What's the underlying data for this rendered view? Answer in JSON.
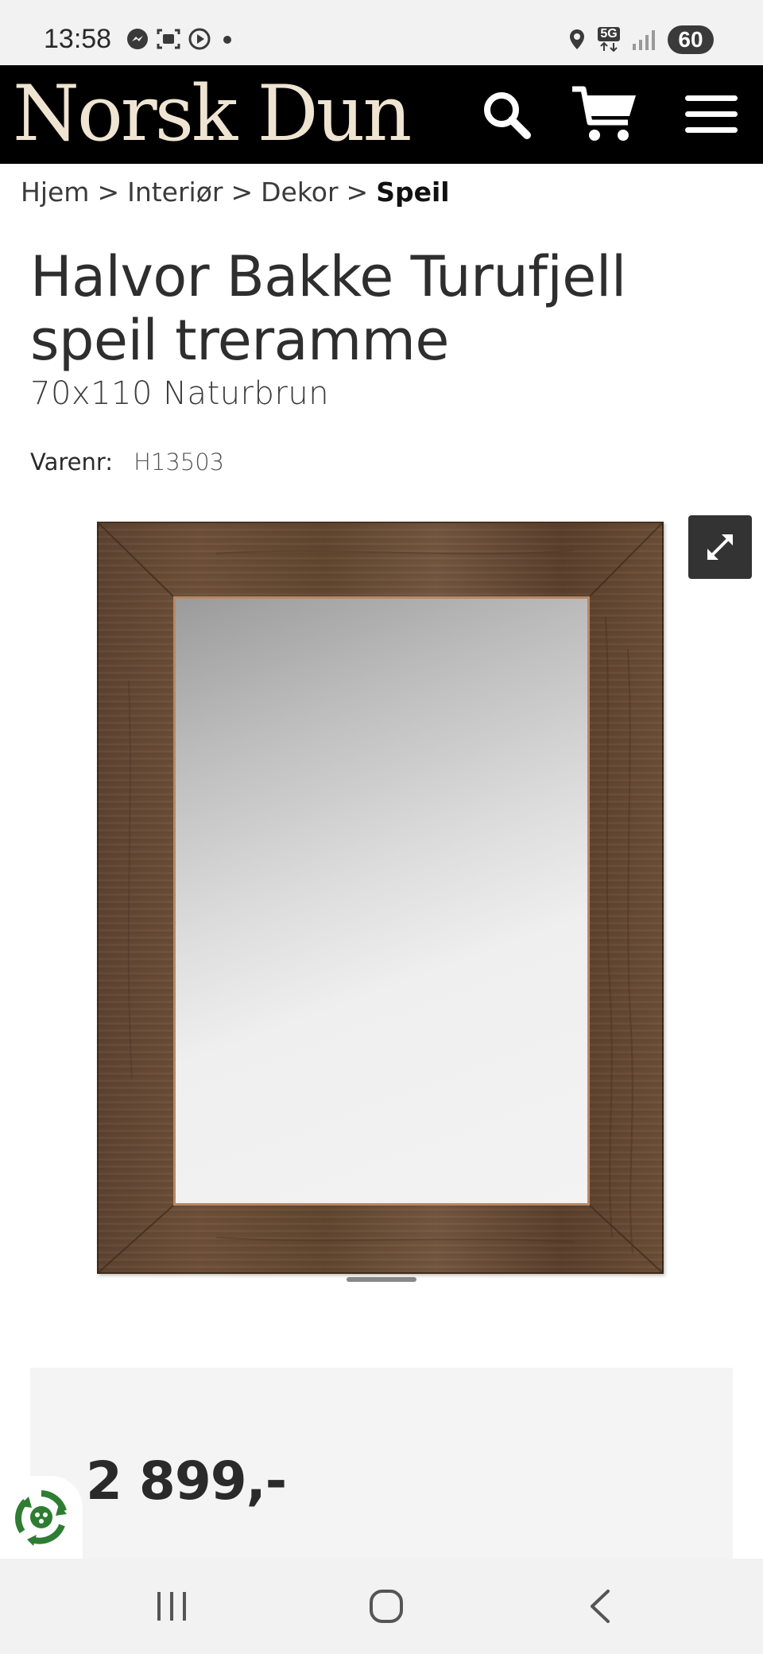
{
  "status_bar": {
    "time": "13:58",
    "battery": "60",
    "network": "5G",
    "icons_left": [
      "messenger-icon",
      "screenshot-icon",
      "play-icon",
      "dot-icon"
    ],
    "icons_right": [
      "location-icon",
      "5g-icon",
      "signal-icon",
      "battery-icon"
    ]
  },
  "header": {
    "logo": "Norsk Dun",
    "background": "#000000",
    "logo_color": "#efe4d2",
    "icons": [
      "search-icon",
      "cart-icon",
      "menu-icon"
    ]
  },
  "breadcrumb": {
    "items": [
      "Hjem",
      "Interiør",
      "Dekor"
    ],
    "separator": ">",
    "current": "Speil"
  },
  "product": {
    "title": "Halvor Bakke Turufjell speil treramme",
    "subtitle": "70x110 Naturbrun",
    "sku_label": "Varenr:",
    "sku_value": "H13503",
    "image_alt": "mirror-with-wooden-frame",
    "price": "2 899,-"
  },
  "gallery": {
    "expand_icon": "expand-icon"
  },
  "nav_bar": {
    "buttons": [
      "recents-icon",
      "home-icon",
      "back-icon"
    ]
  },
  "eco_badge": {
    "icon": "recycle-icon",
    "color": "#2e7d32"
  }
}
